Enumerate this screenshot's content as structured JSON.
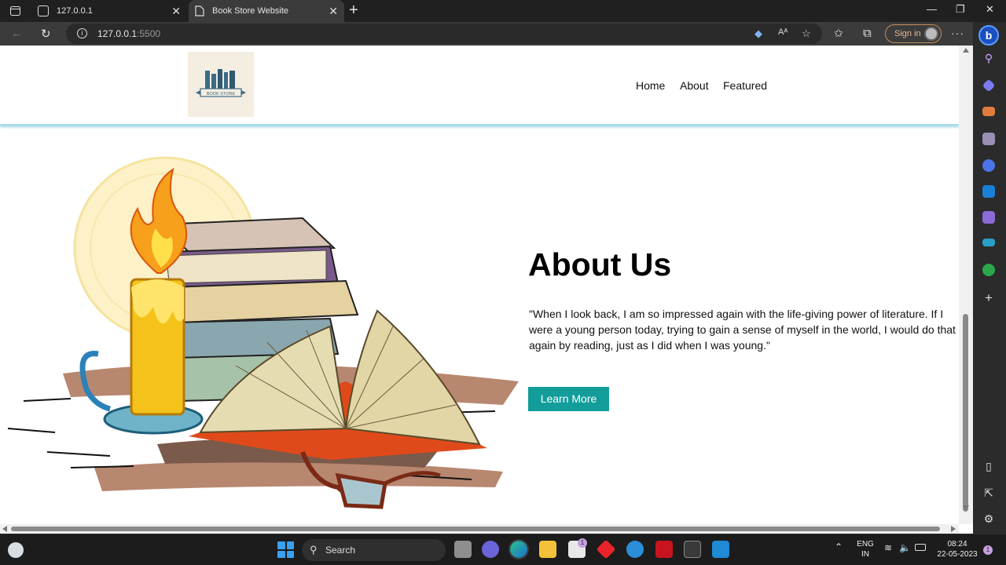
{
  "browser": {
    "tabs": [
      {
        "label": "127.0.0.1"
      },
      {
        "label": "Book Store Website"
      }
    ],
    "address": {
      "host": "127.0.0.1",
      "port": ":5500"
    },
    "signin_label": "Sign in"
  },
  "site": {
    "logo_text": "BOOK STORE",
    "nav": [
      {
        "label": "Home"
      },
      {
        "label": "About"
      },
      {
        "label": "Featured"
      }
    ],
    "about": {
      "title": "About Us",
      "quote": "\"When I look back, I am so impressed again with the life-giving power of literature. If I were a young person today, trying to gain a sense of myself in the world, I would do that again by reading, just as I did when I was young.\"",
      "button_label": "Learn More"
    },
    "colors": {
      "accent": "#129d9b",
      "header_shadow": "#a9dbe8"
    }
  },
  "taskbar": {
    "search_label": "Search",
    "lang": "ENG",
    "region": "IN",
    "time": "08:24",
    "date": "22-05-2023",
    "badge_count": "1"
  }
}
